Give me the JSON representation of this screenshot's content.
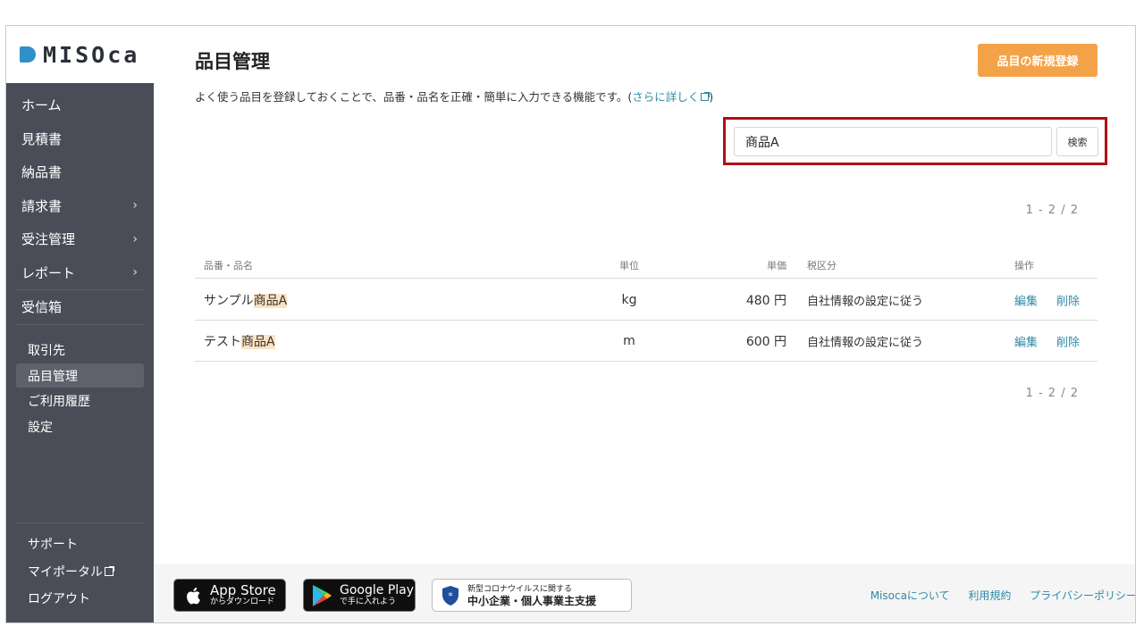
{
  "app": {
    "logo_text": "MISOca"
  },
  "sidebar": {
    "main_items": [
      {
        "label": "ホーム",
        "has_arrow": false
      },
      {
        "label": "見積書",
        "has_arrow": false
      },
      {
        "label": "納品書",
        "has_arrow": false
      },
      {
        "label": "請求書",
        "has_arrow": true
      },
      {
        "label": "受注管理",
        "has_arrow": true
      },
      {
        "label": "レポート",
        "has_arrow": true
      },
      {
        "label": "受信箱",
        "has_arrow": false
      }
    ],
    "sub_items": [
      {
        "label": "取引先",
        "active": false
      },
      {
        "label": "品目管理",
        "active": true
      },
      {
        "label": "ご利用履歴",
        "active": false
      },
      {
        "label": "設定",
        "active": false
      }
    ],
    "bottom_items": [
      {
        "label": "サポート"
      },
      {
        "label": "マイポータル"
      },
      {
        "label": "ログアウト"
      }
    ],
    "arrow_glyph": "›"
  },
  "page": {
    "title": "品目管理",
    "new_button": "品目の新規登録",
    "description_before": "よく使う品目を登録しておくことで、品番・品名を正確・簡単に入力できる機能です。(",
    "description_link": "さらに詳しく",
    "description_after": ")"
  },
  "search": {
    "value": "商品A",
    "button": "検索"
  },
  "pagination": {
    "top": "1 - 2 / 2",
    "bottom": "1 - 2 / 2"
  },
  "table": {
    "headers": {
      "name": "品番・品名",
      "unit": "単位",
      "price": "単価",
      "tax": "税区分",
      "ops": "操作"
    },
    "rows": [
      {
        "name_prefix": "サンプル",
        "name_match": "商品A",
        "unit": "kg",
        "price": "480 円",
        "tax": "自社情報の設定に従う",
        "edit": "編集",
        "delete": "削除"
      },
      {
        "name_prefix": "テスト",
        "name_match": "商品A",
        "unit": "m",
        "price": "600 円",
        "tax": "自社情報の設定に従う",
        "edit": "編集",
        "delete": "削除"
      }
    ]
  },
  "footer": {
    "app_store": {
      "line1": "App Store",
      "line2": "からダウンロード"
    },
    "google_play": {
      "line1": "Google Play",
      "line2": "で手に入れよう"
    },
    "corona": {
      "line1": "新型コロナウイルスに関する",
      "line2": "中小企業・個人事業主支援"
    },
    "links": [
      "Misocaについて",
      "利用規約",
      "プライバシーポリシー"
    ]
  },
  "colors": {
    "accent_orange": "#f4a248",
    "link_blue": "#2e8aa6",
    "sidebar_bg": "#4a4d57",
    "highlight": "#fde3c3",
    "search_frame": "#b10f14"
  }
}
